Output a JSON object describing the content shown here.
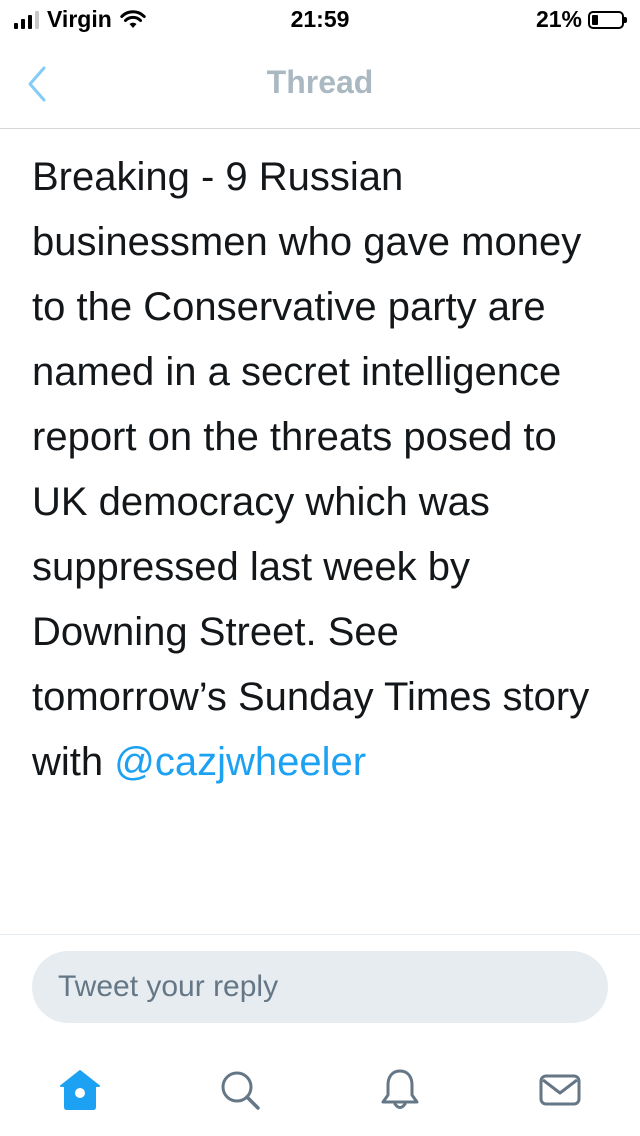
{
  "status_bar": {
    "carrier": "Virgin",
    "time": "21:59",
    "battery": "21%",
    "battery_level": 0.21
  },
  "nav": {
    "title": "Thread",
    "back_icon": "chevron-left-icon"
  },
  "tweet": {
    "text": "Breaking - 9 Russian businessmen who gave money to the Conservative party are named in a secret intelligence report on the threats posed to UK democracy which was suppressed last week by Downing Street. See tomorrow’s Sunday Times story with ",
    "mention": "@cazjwheeler"
  },
  "reply": {
    "placeholder": "Tweet your reply"
  },
  "tabs": [
    {
      "icon": "home-icon",
      "active": true
    },
    {
      "icon": "search-icon",
      "active": false
    },
    {
      "icon": "bell-icon",
      "active": false
    },
    {
      "icon": "mail-icon",
      "active": false
    }
  ],
  "colors": {
    "accent": "#1da1f2",
    "text": "#14171a",
    "muted": "#657786",
    "title": "#aab8c2",
    "reply_bg": "#e6ecf0"
  }
}
